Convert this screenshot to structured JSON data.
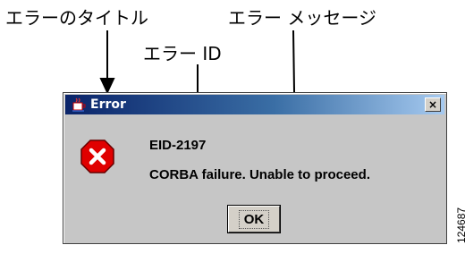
{
  "callouts": {
    "title_label": "エラーのタイトル",
    "message_label": "エラー メッセージ",
    "id_label": "エラー ID"
  },
  "dialog": {
    "title": "Error",
    "close_label": "×",
    "error_id": "EID-2197",
    "message": "CORBA failure.  Unable to proceed.",
    "ok_label": "OK",
    "icons": {
      "app": "java-cup-icon",
      "error": "error-stop-icon"
    },
    "colors": {
      "title_active": "#0a246a",
      "title_fade": "#a6caf0",
      "body": "#c6c6c6",
      "error_red": "#e00000"
    }
  },
  "figure_number": "124687"
}
